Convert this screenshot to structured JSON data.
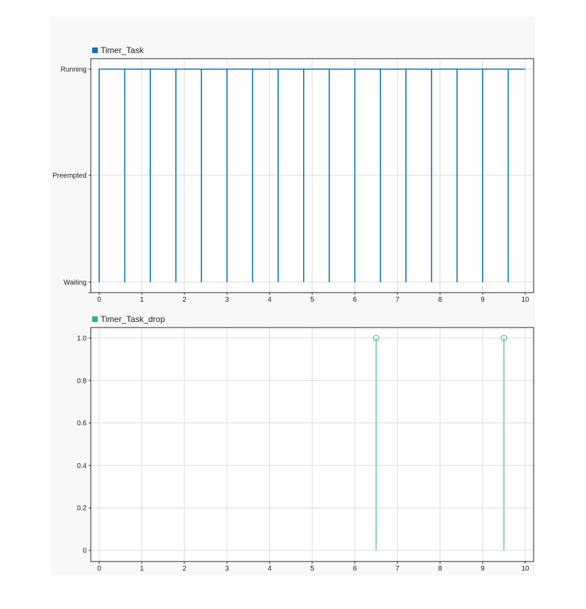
{
  "chart_data": [
    {
      "type": "line",
      "legend": "Timer_Task",
      "color": "#0072bd",
      "x_ticks": [
        "0",
        "1",
        "2",
        "3",
        "4",
        "5",
        "6",
        "7",
        "8",
        "9",
        "10"
      ],
      "xlim": [
        0,
        10
      ],
      "y_categories": [
        "Waiting",
        "Preempted",
        "Running"
      ],
      "grid": true,
      "series": [
        {
          "x": [
            0,
            0,
            0.6,
            0.6,
            0.6,
            1.2,
            1.2,
            1.2,
            1.8,
            1.8,
            1.8,
            2.4,
            2.4,
            2.4,
            3.0,
            3.0,
            3.0,
            3.6,
            3.6,
            3.6,
            4.2,
            4.2,
            4.2,
            4.8,
            4.8,
            4.8,
            5.4,
            5.4,
            5.4,
            6.0,
            6.0,
            6.0,
            6.6,
            6.6,
            6.6,
            7.2,
            7.2,
            7.2,
            7.8,
            7.8,
            7.8,
            8.4,
            8.4,
            8.4,
            9.0,
            9.0,
            9.0,
            9.6,
            9.6,
            9.6,
            10
          ],
          "y": [
            "Waiting",
            "Running",
            "Running",
            "Waiting",
            "Running",
            "Running",
            "Waiting",
            "Running",
            "Running",
            "Waiting",
            "Running",
            "Running",
            "Waiting",
            "Running",
            "Running",
            "Waiting",
            "Running",
            "Running",
            "Waiting",
            "Running",
            "Running",
            "Waiting",
            "Running",
            "Running",
            "Waiting",
            "Running",
            "Running",
            "Waiting",
            "Running",
            "Running",
            "Waiting",
            "Running",
            "Running",
            "Waiting",
            "Running",
            "Running",
            "Waiting",
            "Running",
            "Running",
            "Waiting",
            "Running",
            "Running",
            "Waiting",
            "Running",
            "Running",
            "Waiting",
            "Running",
            "Running",
            "Waiting",
            "Running",
            "Running"
          ]
        }
      ]
    },
    {
      "type": "stem",
      "legend": "Timer_Task_drop",
      "color": "#2fb37f",
      "x_ticks": [
        "0",
        "1",
        "2",
        "3",
        "4",
        "5",
        "6",
        "7",
        "8",
        "9",
        "10"
      ],
      "y_ticks": [
        "0",
        "0.2",
        "0.4",
        "0.6",
        "0.8",
        "1.0"
      ],
      "xlim": [
        0,
        10
      ],
      "ylim": [
        0,
        1.0
      ],
      "grid": true,
      "series": [
        {
          "x": [
            6.5,
            9.5
          ],
          "y": [
            1.0,
            1.0
          ]
        }
      ]
    }
  ]
}
